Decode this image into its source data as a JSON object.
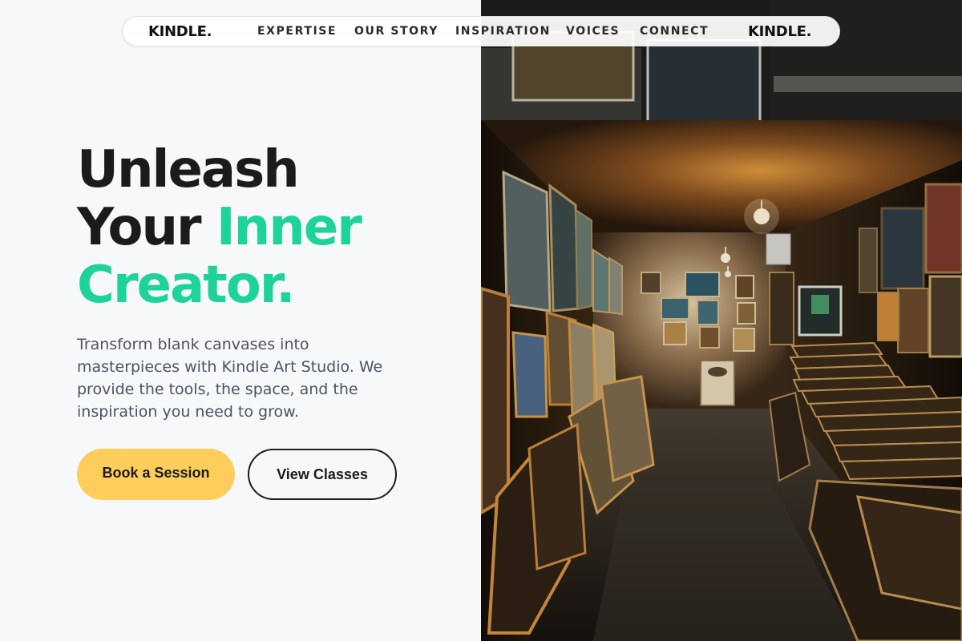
{
  "nav": {
    "logo": "KINDLE.",
    "logo_secondary": "KINDLE.",
    "links": [
      "EXPERTISE",
      "OUR STORY",
      "INSPIRATION",
      "VOICES",
      "CONNECT"
    ]
  },
  "hero": {
    "title_line1": "Unleash",
    "title_line2_plain": "Your",
    "title_line2_accent": "Inner",
    "title_line3": "Creator.",
    "description": "Transform blank canvases into masterpieces with Kindle Art Studio. We provide the tools, the space, and the inspiration you need to grow.",
    "primary_button": "Book a Session",
    "secondary_button": "View Classes"
  },
  "image": {
    "subject": "art-gallery-storeroom-photo"
  },
  "colors": {
    "accent": "#1ed39a",
    "primary_button": "#ffcd5c",
    "heading": "#1b1b1b",
    "body_text": "#4c5361",
    "background": "#f7f8fa"
  }
}
